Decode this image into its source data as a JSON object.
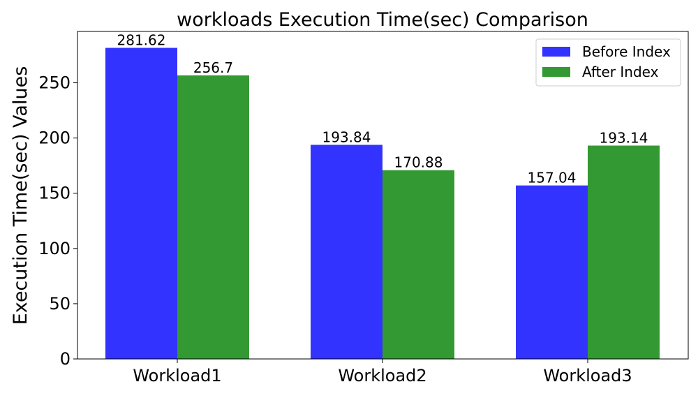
{
  "chart_data": {
    "type": "bar",
    "title": "workloads Execution Time(sec) Comparison",
    "xlabel": "",
    "ylabel": "Execution Time(sec) Values",
    "categories": [
      "Workload1",
      "Workload2",
      "Workload3"
    ],
    "series": [
      {
        "name": "Before Index",
        "color": "#3333ff",
        "values": [
          281.62,
          193.84,
          157.04
        ],
        "labels": [
          "281.62",
          "193.84",
          "157.04"
        ]
      },
      {
        "name": "After Index",
        "color": "#339933",
        "values": [
          256.7,
          170.88,
          193.14
        ],
        "labels": [
          "256.7",
          "170.88",
          "193.14"
        ]
      }
    ],
    "ylim": [
      0,
      296.5
    ],
    "yticks": [
      0,
      50,
      100,
      150,
      200,
      250
    ],
    "ytick_labels": [
      "0",
      "50",
      "100",
      "150",
      "200",
      "250"
    ],
    "grid": false,
    "legend_position": "top-right"
  }
}
